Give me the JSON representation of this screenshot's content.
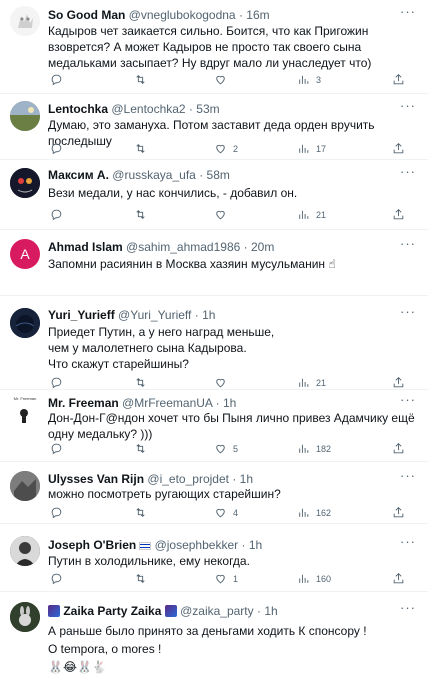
{
  "tweets": [
    {
      "name": "So Good Man",
      "handle": "@vneglubokogodna",
      "time": "16m",
      "text": "Кадыров чет заикается сильно. Боится, что как Пригожин взоврется? А может Кадыров не просто так своего сына медальками засыпает? Ну вдруг мало ли унаследует что)",
      "replies": "",
      "retweets": "",
      "likes": "",
      "views": "3",
      "avatar_color": "#e8e8e8"
    },
    {
      "name": "Lentochka",
      "handle": "@Lentochka2",
      "time": "53m",
      "text": "Думаю, это замануха. Потом заставит деда орден вручить последышу",
      "replies": "",
      "retweets": "",
      "likes": "2",
      "views": "17",
      "avatar_color": "#7a8a5a"
    },
    {
      "name": "Максим А.",
      "handle": "@russkaya_ufa",
      "time": "58m",
      "text": "Вези медали, у нас кончились, - добавил он.",
      "replies": "",
      "retweets": "",
      "likes": "",
      "views": "21",
      "avatar_color": "#1a1d2e"
    },
    {
      "name": "Ahmad Islam",
      "handle": "@sahim_ahmad1986",
      "time": "20m",
      "text": "Запомни расиянин в Москва хазяин мусульманин ☝",
      "replies": "",
      "retweets": "",
      "likes": "",
      "views": "",
      "avatar_color": "#d81b60",
      "avatar_letter": "A"
    },
    {
      "name": "Yuri_Yurieff",
      "handle": "@Yuri_Yurieff",
      "time": "1h",
      "text": "Приедет Путин, а у него наград меньше,\nчем у малолетнего сына Кадырова.\nЧто скажут старейшины?",
      "replies": "",
      "retweets": "",
      "likes": "",
      "views": "21",
      "avatar_color": "#152238"
    },
    {
      "name": "Mr. Freeman",
      "handle": "@MrFreemanUA",
      "time": "1h",
      "text": "Дон-Дон-Г@ндон хочет что бы Пыня лично привез Адамчику ещё одну медальку? )))",
      "replies": "",
      "retweets": "",
      "likes": "5",
      "views": "182",
      "avatar_color": "#ffffff",
      "avatar_caption": "Mr. Freeman"
    },
    {
      "name": "Ulysses Van Rijn",
      "handle": "@i_eto_projdet",
      "time": "1h",
      "text": "можно посмотреть ругающих старейшин?",
      "replies": "",
      "retweets": "",
      "likes": "4",
      "views": "162",
      "avatar_color": "#6d6d6d"
    },
    {
      "name": "Joseph O'Brien",
      "handle": "@josephbekker",
      "time": "1h",
      "text": "Путин в холодильнике, ему некогда.",
      "replies": "",
      "retweets": "",
      "likes": "1",
      "views": "160",
      "avatar_color": "#3a3a3a"
    },
    {
      "name": "Zaika Party Zaika",
      "handle": "@zaika_party",
      "time": "1h",
      "text": "А раньше  было принято за деньгами ходить К спонсору !\nO tempora, o mores !\n🐰😂🐰🐇",
      "replies": "",
      "retweets": "",
      "likes": "",
      "views": "",
      "avatar_color": "#2e3b2a"
    }
  ],
  "more_label": "···"
}
